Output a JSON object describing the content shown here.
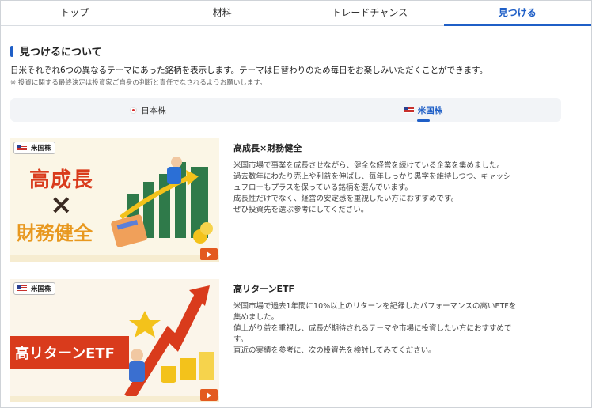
{
  "nav": {
    "tabs": [
      {
        "label": "トップ"
      },
      {
        "label": "材料"
      },
      {
        "label": "トレードチャンス"
      },
      {
        "label": "見つける",
        "active": true
      }
    ]
  },
  "section": {
    "title": "見つけるについて",
    "description": "日米それぞれ6つの異なるテーマにあった銘柄を表示します。テーマは日替わりのため毎日をお楽しみいただくことができます。",
    "note": "※ 投資に関する最終決定は投資家ご自身の判断と責任でなされるようお願いします。"
  },
  "market_tabs": [
    {
      "label": "日本株",
      "flag": "jp-flag",
      "active": false
    },
    {
      "label": "米国株",
      "flag": "us-flag",
      "active": true
    }
  ],
  "cards": [
    {
      "badge": "米国株",
      "image_text": {
        "line1": "高成長",
        "mark": "×",
        "line2": "財務健全"
      },
      "title": "高成長×財務健全",
      "lines": [
        "米国市場で事業を成長させながら、健全な経営を続けている企業を集めました。",
        "過去数年にわたり売上や利益を伸ばし、毎年しっかり黒字を維持しつつ、キャッシ",
        "ュフローもプラスを保っている銘柄を選んでいます。",
        "成長性だけでなく、経営の安定感を重視したい方におすすめです。",
        "ぜひ投資先を選ぶ参考にしてください。"
      ]
    },
    {
      "badge": "米国株",
      "image_text": {
        "line1": "高リターンETF"
      },
      "title": "高リターンETF",
      "lines": [
        "米国市場で過去1年間に10%以上のリターンを記録したパフォーマンスの高いETFを",
        "集めました。",
        "値上がり益を重視し、成長が期待されるテーマや市場に投資したい方におすすめで",
        "す。",
        "直近の実績を参考に、次の投資先を検討してみてください。"
      ]
    }
  ],
  "colors": {
    "accent": "#1f5fc7",
    "play": "#e35a1f",
    "red_banner": "#d93b1c"
  }
}
